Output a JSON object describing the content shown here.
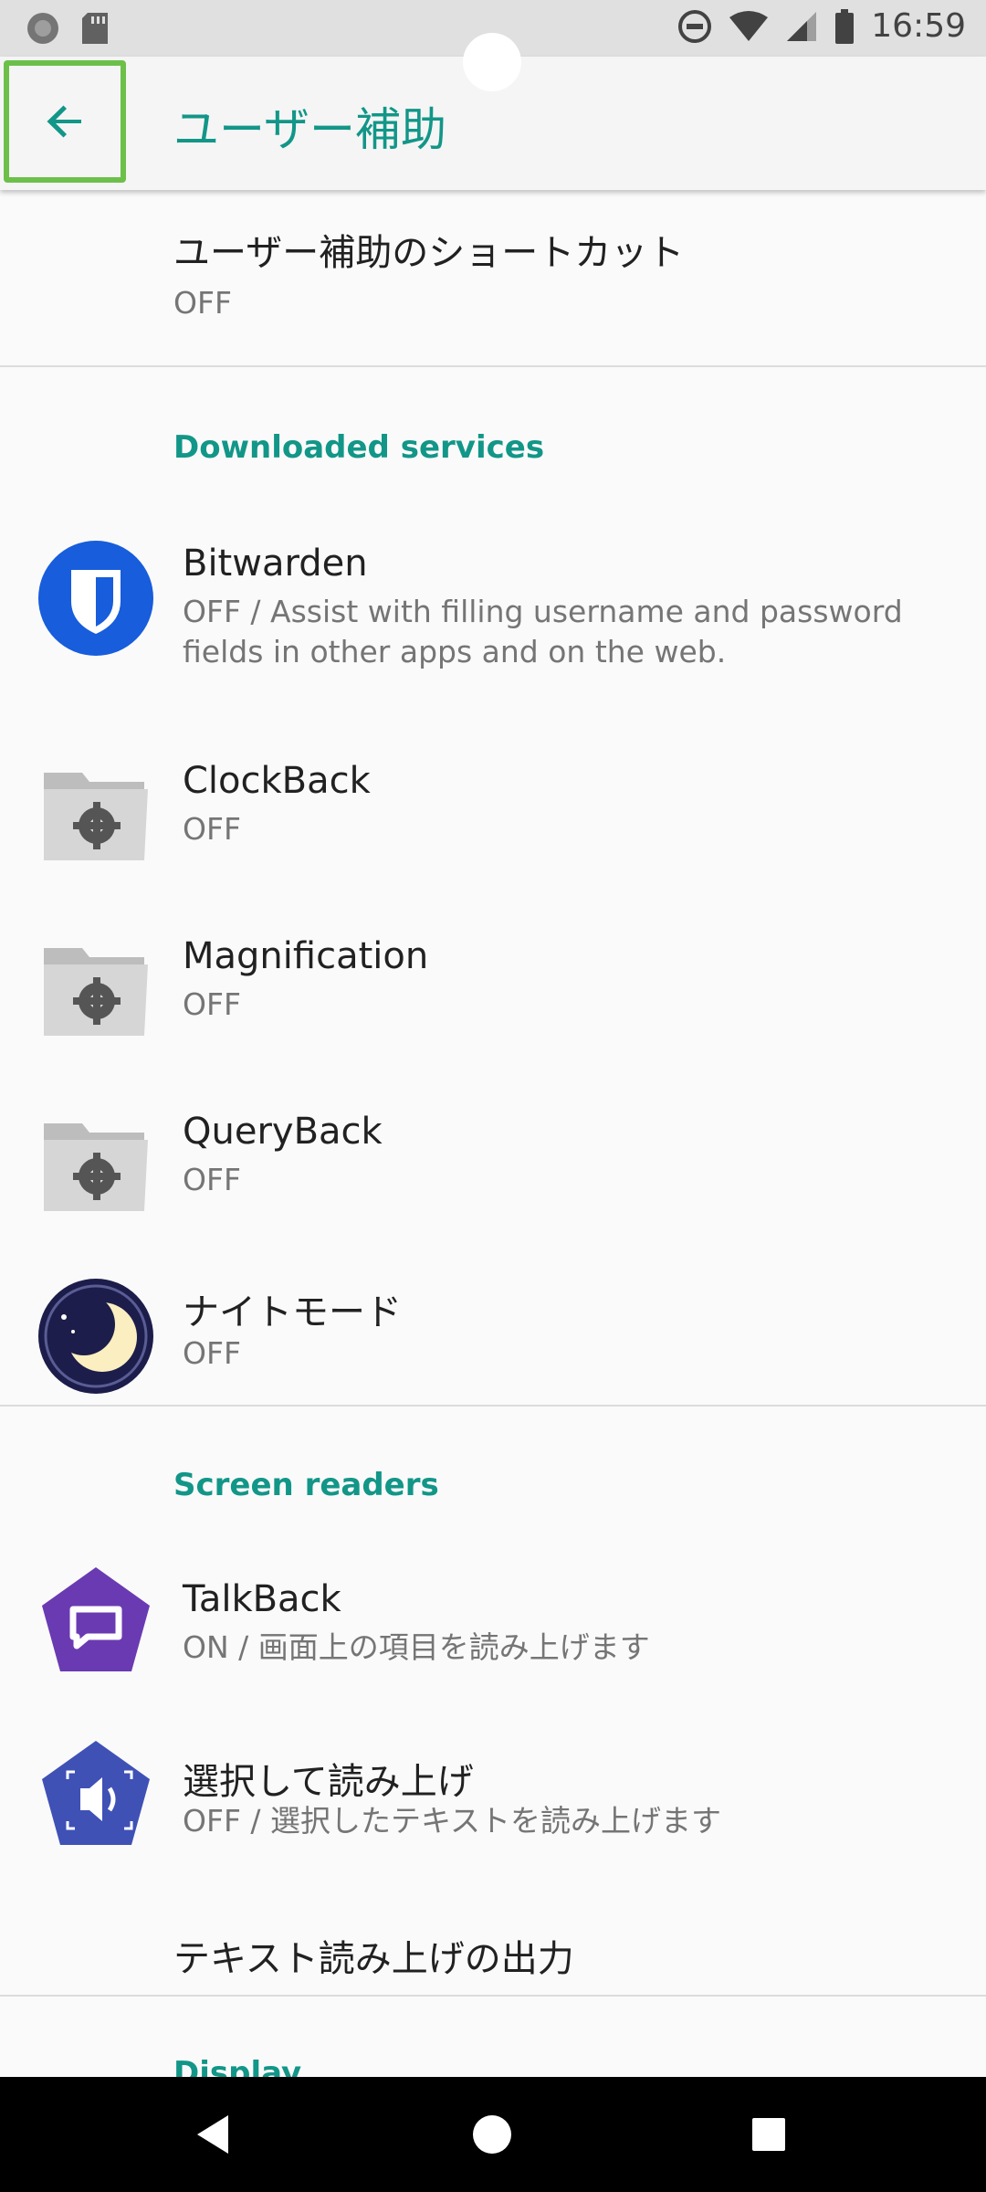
{
  "status_bar": {
    "time": "16:59"
  },
  "app_bar": {
    "title": "ユーザー補助"
  },
  "shortcut": {
    "title": "ユーザー補助のショートカット",
    "subtitle": "OFF"
  },
  "sections": {
    "downloaded": {
      "header": "Downloaded services",
      "items": [
        {
          "title": "Bitwarden",
          "subtitle": "OFF / Assist with filling username and password",
          "subtitle2": "fields in other apps and on the web.",
          "icon": "bitwarden-icon"
        },
        {
          "title": "ClockBack",
          "subtitle": "OFF",
          "icon": "folder-gear-icon"
        },
        {
          "title": "Magnification",
          "subtitle": "OFF",
          "icon": "folder-gear-icon"
        },
        {
          "title": "QueryBack",
          "subtitle": "OFF",
          "icon": "folder-gear-icon"
        },
        {
          "title": "ナイトモード",
          "subtitle": "OFF",
          "icon": "moon-icon"
        }
      ]
    },
    "screen_readers": {
      "header": "Screen readers",
      "items": [
        {
          "title": "TalkBack",
          "subtitle": "ON / 画面上の項目を読み上げます",
          "icon": "talkback-icon"
        },
        {
          "title": "選択して読み上げ",
          "subtitle": "OFF / 選択したテキストを読み上げます",
          "icon": "select-to-speak-icon"
        },
        {
          "title": "テキスト読み上げの出力"
        }
      ]
    },
    "display": {
      "header": "Display"
    }
  },
  "colors": {
    "accent": "#129688",
    "highlight": "#6cc04a",
    "bitwarden": "#175ddc",
    "talkback": "#6a3ab2",
    "select_to_speak": "#3f51b5"
  }
}
